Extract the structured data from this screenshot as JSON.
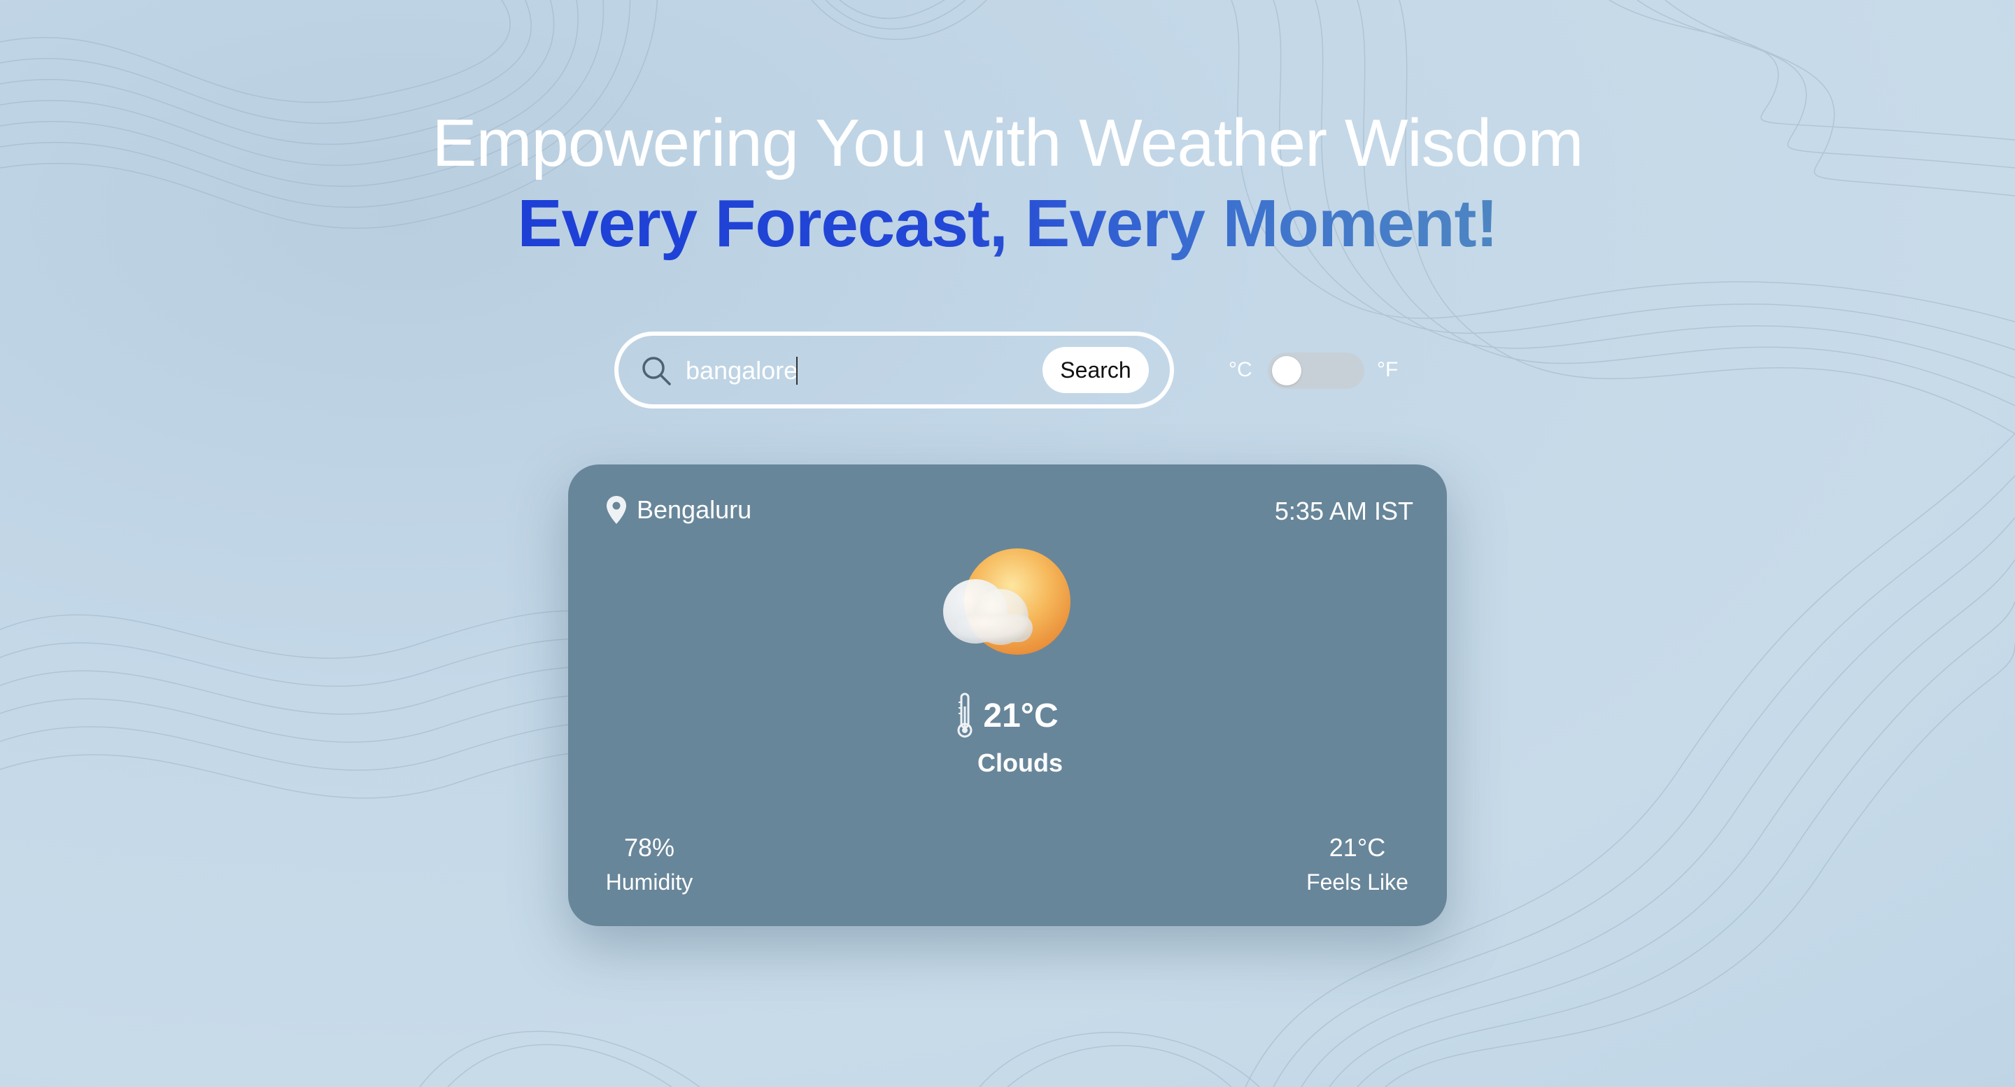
{
  "hero": {
    "title_line1": "Empowering You with Weather Wisdom",
    "title_line2": "Every Forecast, Every Moment!"
  },
  "search": {
    "value": "bangalore",
    "button_label": "Search",
    "icon": "search-icon"
  },
  "unit_toggle": {
    "celsius_label": "°C",
    "fahrenheit_label": "°F",
    "selected": "°C"
  },
  "weather_card": {
    "city": "Bengaluru",
    "time": "5:35 AM IST",
    "temperature": "21°C",
    "condition": "Clouds",
    "condition_icon": "sun-cloud-icon",
    "humidity_value": "78%",
    "humidity_label": "Humidity",
    "feels_like_value": "21°C",
    "feels_like_label": "Feels Like"
  },
  "colors": {
    "background": "#c4d8e8",
    "card": "#68869a",
    "accent_blue": "#1d3fd6",
    "accent_blue_light": "#4e86c2"
  }
}
